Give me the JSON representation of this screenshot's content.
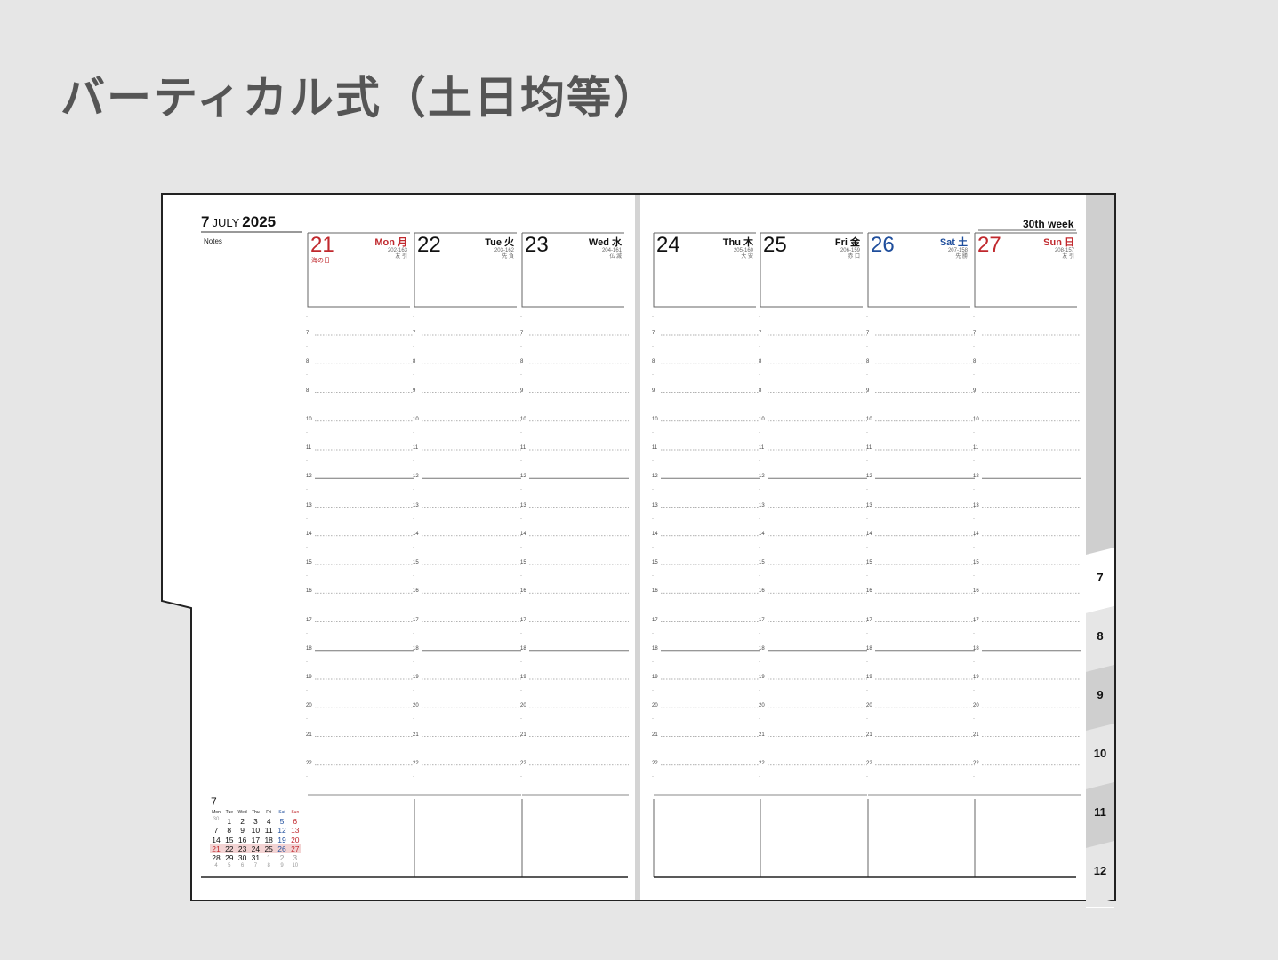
{
  "heading": "バーティカル式（土日均等）",
  "planner": {
    "month_number": "7",
    "month_name": "JULY",
    "year": "2025",
    "notes_label": "Notes",
    "week_label": "30th week",
    "days": [
      {
        "num": "21",
        "name": "Mon 月",
        "sub1": "202-163",
        "sub2": "友 引",
        "holiday": "海の日",
        "color": "#c0282d"
      },
      {
        "num": "22",
        "name": "Tue 火",
        "sub1": "203-162",
        "sub2": "先 負",
        "holiday": "",
        "color": "#111111"
      },
      {
        "num": "23",
        "name": "Wed 水",
        "sub1": "204-161",
        "sub2": "仏 滅",
        "holiday": "",
        "color": "#111111"
      },
      {
        "num": "24",
        "name": "Thu 木",
        "sub1": "205-160",
        "sub2": "大 安",
        "holiday": "",
        "color": "#111111"
      },
      {
        "num": "25",
        "name": "Fri 金",
        "sub1": "206-159",
        "sub2": "赤 口",
        "holiday": "",
        "color": "#111111"
      },
      {
        "num": "26",
        "name": "Sat 土",
        "sub1": "207-158",
        "sub2": "先 勝",
        "holiday": "",
        "color": "#1f4e9c"
      },
      {
        "num": "27",
        "name": "Sun 日",
        "sub1": "208-157",
        "sub2": "友 引",
        "holiday": "",
        "color": "#c0282d"
      }
    ],
    "columns_hours": [
      [
        "7",
        "8",
        "8",
        "10",
        "11",
        "12",
        "13",
        "14",
        "15",
        "16",
        "17",
        "18",
        "19",
        "20",
        "21",
        "22"
      ],
      [
        "7",
        "8",
        "9",
        "10",
        "11",
        "12",
        "13",
        "14",
        "15",
        "16",
        "17",
        "18",
        "19",
        "20",
        "21",
        "22"
      ],
      [
        "7",
        "8",
        "9",
        "10",
        "11",
        "12",
        "13",
        "14",
        "15",
        "16",
        "17",
        "18",
        "19",
        "20",
        "21",
        "22"
      ],
      [
        "7",
        "8",
        "9",
        "10",
        "11",
        "12",
        "13",
        "14",
        "15",
        "16",
        "17",
        "18",
        "19",
        "20",
        "21",
        "22"
      ],
      [
        "7",
        "8",
        "8",
        "10",
        "11",
        "12",
        "13",
        "14",
        "15",
        "16",
        "17",
        "18",
        "19",
        "20",
        "21",
        "22"
      ],
      [
        "7",
        "8",
        "9",
        "10",
        "11",
        "12",
        "13",
        "14",
        "15",
        "16",
        "17",
        "18",
        "19",
        "20",
        "21",
        "22"
      ],
      [
        "7",
        "8",
        "9",
        "10",
        "11",
        "12",
        "13",
        "14",
        "15",
        "16",
        "17",
        "18",
        "19",
        "20",
        "21",
        "22"
      ]
    ],
    "mini_calendar": {
      "month": "7",
      "headers": [
        "Mon",
        "Tue",
        "Wed",
        "Thu",
        "Fri",
        "Sat",
        "Sun"
      ],
      "weeks": [
        [
          "30",
          "1",
          "2",
          "3",
          "4",
          "5",
          "6"
        ],
        [
          "7",
          "8",
          "9",
          "10",
          "11",
          "12",
          "13"
        ],
        [
          "14",
          "15",
          "16",
          "17",
          "18",
          "19",
          "20"
        ],
        [
          "21",
          "22",
          "23",
          "24",
          "25",
          "26",
          "27"
        ],
        [
          "28",
          "29",
          "30",
          "31",
          "1",
          "2",
          "3"
        ],
        [
          "4",
          "5",
          "6",
          "7",
          "8",
          "9",
          "10"
        ]
      ],
      "colors": {
        "weekday": "#111111",
        "saturday": "#1f4e9c",
        "sunday": "#c0282d",
        "holiday": "#c0282d",
        "other_month": "#999999",
        "highlight": "#f3d3d3"
      }
    },
    "tabs": [
      "7",
      "8",
      "9",
      "10",
      "11",
      "12"
    ],
    "colors": {
      "tab_dark": "#cfcfcf",
      "tab_light": "#e6e6e6",
      "frame": "#222222",
      "rule": "#666666"
    }
  }
}
